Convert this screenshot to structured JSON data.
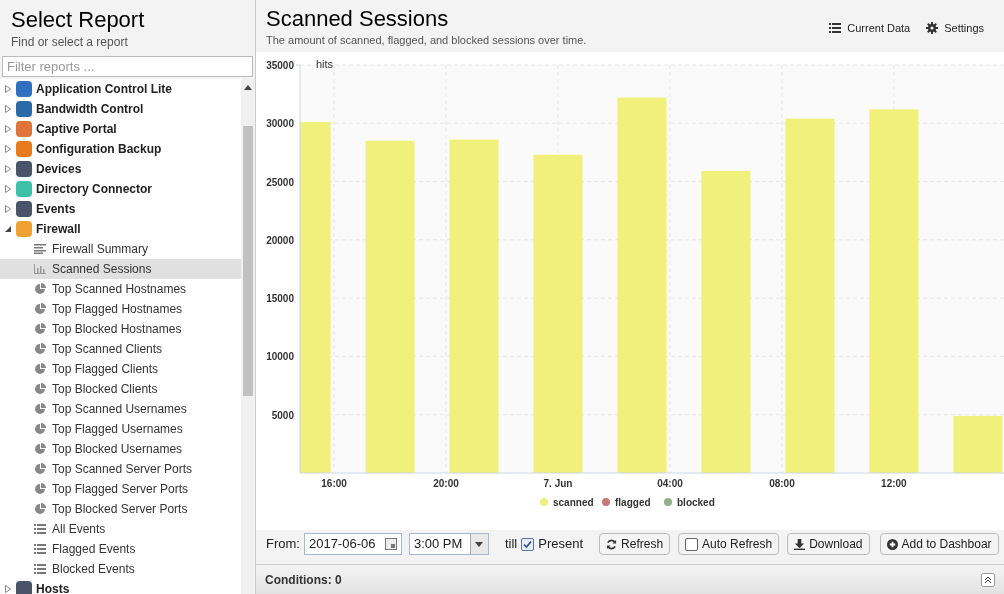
{
  "sidebar": {
    "title": "Select Report",
    "subtitle": "Find or select a report",
    "filter": {
      "placeholder": "Filter reports ..."
    },
    "items": [
      {
        "label": "Application Control Lite",
        "expanded": false,
        "color": "#2f6fc0"
      },
      {
        "label": "Bandwidth Control",
        "expanded": false,
        "color": "#2a6aa8"
      },
      {
        "label": "Captive Portal",
        "expanded": false,
        "color": "#e0733a"
      },
      {
        "label": "Configuration Backup",
        "expanded": false,
        "color": "#e87a1e"
      },
      {
        "label": "Devices",
        "expanded": false,
        "color": "#4a5468"
      },
      {
        "label": "Directory Connector",
        "expanded": false,
        "color": "#3cc0a8"
      },
      {
        "label": "Events",
        "expanded": false,
        "color": "#4a5468"
      },
      {
        "label": "Firewall",
        "expanded": true,
        "color": "#f0a030",
        "children": [
          {
            "label": "Firewall Summary",
            "kind": "summary",
            "selected": false
          },
          {
            "label": "Scanned Sessions",
            "kind": "bar",
            "selected": true
          },
          {
            "label": "Top Scanned Hostnames",
            "kind": "pie",
            "selected": false
          },
          {
            "label": "Top Flagged Hostnames",
            "kind": "pie",
            "selected": false
          },
          {
            "label": "Top Blocked Hostnames",
            "kind": "pie",
            "selected": false
          },
          {
            "label": "Top Scanned Clients",
            "kind": "pie",
            "selected": false
          },
          {
            "label": "Top Flagged Clients",
            "kind": "pie",
            "selected": false
          },
          {
            "label": "Top Blocked Clients",
            "kind": "pie",
            "selected": false
          },
          {
            "label": "Top Scanned Usernames",
            "kind": "pie",
            "selected": false
          },
          {
            "label": "Top Flagged Usernames",
            "kind": "pie",
            "selected": false
          },
          {
            "label": "Top Blocked Usernames",
            "kind": "pie",
            "selected": false
          },
          {
            "label": "Top Scanned Server Ports",
            "kind": "pie",
            "selected": false
          },
          {
            "label": "Top Flagged Server Ports",
            "kind": "pie",
            "selected": false
          },
          {
            "label": "Top Blocked Server Ports",
            "kind": "pie",
            "selected": false
          },
          {
            "label": "All Events",
            "kind": "list",
            "selected": false
          },
          {
            "label": "Flagged Events",
            "kind": "list",
            "selected": false
          },
          {
            "label": "Blocked Events",
            "kind": "list",
            "selected": false
          }
        ]
      },
      {
        "label": "Hosts",
        "expanded": false,
        "color": "#4a5468"
      }
    ]
  },
  "report": {
    "title": "Scanned Sessions",
    "subtitle": "The amount of scanned, flagged, and blocked sessions over time.",
    "actions": [
      "Current Data",
      "Settings"
    ],
    "chart_data": {
      "type": "bar",
      "ylabel": "hits",
      "x": [
        "2017-06-06T15:00",
        "2017-06-06T18:00",
        "2017-06-06T21:00",
        "2017-06-07T00:00",
        "2017-06-07T03:00",
        "2017-06-07T06:00",
        "2017-06-07T09:00",
        "2017-06-07T12:00",
        "2017-06-07T15:00"
      ],
      "series": [
        {
          "name": "scanned",
          "color": "#f0f07a",
          "values": [
            30100,
            28500,
            28600,
            27300,
            32200,
            25900,
            30400,
            31200,
            4900
          ]
        },
        {
          "name": "flagged",
          "color": "#c87878",
          "values": [
            0,
            0,
            0,
            0,
            0,
            0,
            0,
            0,
            0
          ]
        },
        {
          "name": "blocked",
          "color": "#8fb38a",
          "values": [
            0,
            0,
            0,
            0,
            0,
            0,
            0,
            0,
            0
          ]
        }
      ],
      "xlim": [
        "2017-06-06T14:47",
        "2017-06-07T15:56"
      ],
      "ylim": [
        0,
        35000
      ],
      "grid": true,
      "xticks": [
        {
          "value": "2017-06-06T16:00",
          "label": "16:00"
        },
        {
          "value": "2017-06-06T20:00",
          "label": "20:00"
        },
        {
          "value": "2017-06-07T00:00",
          "label": "7. Jun"
        },
        {
          "value": "2017-06-07T04:00",
          "label": "04:00"
        },
        {
          "value": "2017-06-07T08:00",
          "label": "08:00"
        },
        {
          "value": "2017-06-07T12:00",
          "label": "12:00"
        }
      ],
      "yticks": [
        5000,
        10000,
        15000,
        20000,
        25000,
        30000,
        35000
      ]
    }
  },
  "toolbar": {
    "from_label": "From:",
    "date": "2017-06-06",
    "time": "3:00 PM",
    "till_label": "till",
    "present": {
      "label": "Present",
      "checked": true
    },
    "refresh": "Refresh",
    "auto_refresh": {
      "label": "Auto Refresh",
      "checked": false
    },
    "download": "Download",
    "add": "Add to Dashboar"
  },
  "conditions": "Conditions: 0"
}
